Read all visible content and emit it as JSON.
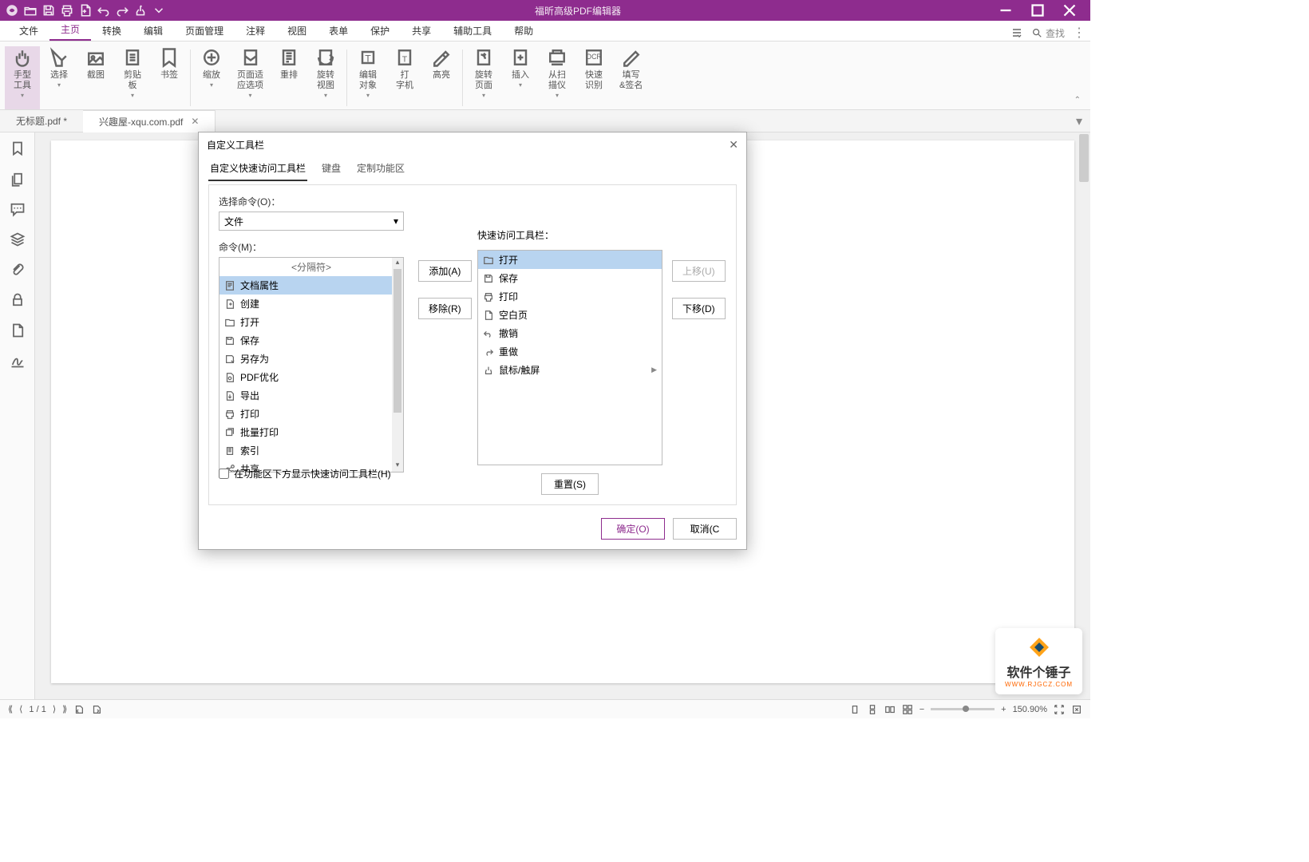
{
  "app": {
    "title": "福昕高级PDF编辑器"
  },
  "qat_icons": [
    "logo",
    "open",
    "save",
    "print",
    "new",
    "undo",
    "redo",
    "touch",
    "dropdown"
  ],
  "menu": {
    "tabs": [
      "文件",
      "主页",
      "转换",
      "编辑",
      "页面管理",
      "注释",
      "视图",
      "表单",
      "保护",
      "共享",
      "辅助工具",
      "帮助"
    ],
    "active": 1
  },
  "search_placeholder": "查找",
  "ribbon": [
    {
      "label": "手型\n工具",
      "dd": true,
      "sel": true
    },
    {
      "label": "选择",
      "dd": true
    },
    {
      "label": "截图"
    },
    {
      "label": "剪贴\n板",
      "dd": true
    },
    {
      "label": "书签",
      "sep": true
    },
    {
      "label": "缩放",
      "dd": true
    },
    {
      "label": "页面适\n应选项",
      "dd": true
    },
    {
      "label": "重排"
    },
    {
      "label": "旋转\n视图",
      "dd": true,
      "sep": true
    },
    {
      "label": "编辑\n对象",
      "dd": true
    },
    {
      "label": "打\n字机"
    },
    {
      "label": "高亮",
      "sep": true
    },
    {
      "label": "旋转\n页面",
      "dd": true
    },
    {
      "label": "插入",
      "dd": true
    },
    {
      "label": "从扫\n描仪",
      "dd": true
    },
    {
      "label": "快速\n识别"
    },
    {
      "label": "填写\n&签名"
    }
  ],
  "doctabs": [
    {
      "label": "无标题.pdf *",
      "active": false
    },
    {
      "label": "兴趣屋-xqu.com.pdf",
      "active": true
    }
  ],
  "sidebar_icons": [
    "bookmark",
    "pages",
    "comments",
    "layers",
    "attachments",
    "security",
    "file",
    "signature"
  ],
  "dialog": {
    "title": "自定义工具栏",
    "tabs": [
      "自定义快速访问工具栏",
      "键盘",
      "定制功能区"
    ],
    "active_tab": 0,
    "select_label": "选择命令(O)：",
    "select_value": "文件",
    "commands_label": "命令(M)：",
    "commands": [
      {
        "label": "<分隔符>",
        "sep": true
      },
      {
        "label": "文档属性",
        "sel": true,
        "sub": true
      },
      {
        "label": "创建",
        "sub": true
      },
      {
        "label": "打开",
        "sub": true
      },
      {
        "label": "保存"
      },
      {
        "label": "另存为",
        "sub": true
      },
      {
        "label": "PDF优化",
        "sub": true
      },
      {
        "label": "导出",
        "sub": true
      },
      {
        "label": "打印"
      },
      {
        "label": "批量打印"
      },
      {
        "label": "索引"
      },
      {
        "label": "共享",
        "sub": true
      }
    ],
    "qat_label": "快速访问工具栏：",
    "qat_items": [
      {
        "label": "打开",
        "sel": true
      },
      {
        "label": "保存"
      },
      {
        "label": "打印"
      },
      {
        "label": "空白页"
      },
      {
        "label": "撤销"
      },
      {
        "label": "重做"
      },
      {
        "label": "鼠标/触屏",
        "sub": true
      }
    ],
    "btn_add": "添加(A)",
    "btn_remove": "移除(R)",
    "btn_up": "上移(U)",
    "btn_down": "下移(D)",
    "btn_reset": "重置(S)",
    "check_label": "在功能区下方显示快速访问工具栏(H)",
    "btn_ok": "确定(O)",
    "btn_cancel": "取消(C"
  },
  "status": {
    "page": "1 / 1",
    "zoom": "150.90%"
  },
  "watermark": {
    "text": "软件个锤子",
    "url": "WWW.RJGCZ.COM"
  }
}
